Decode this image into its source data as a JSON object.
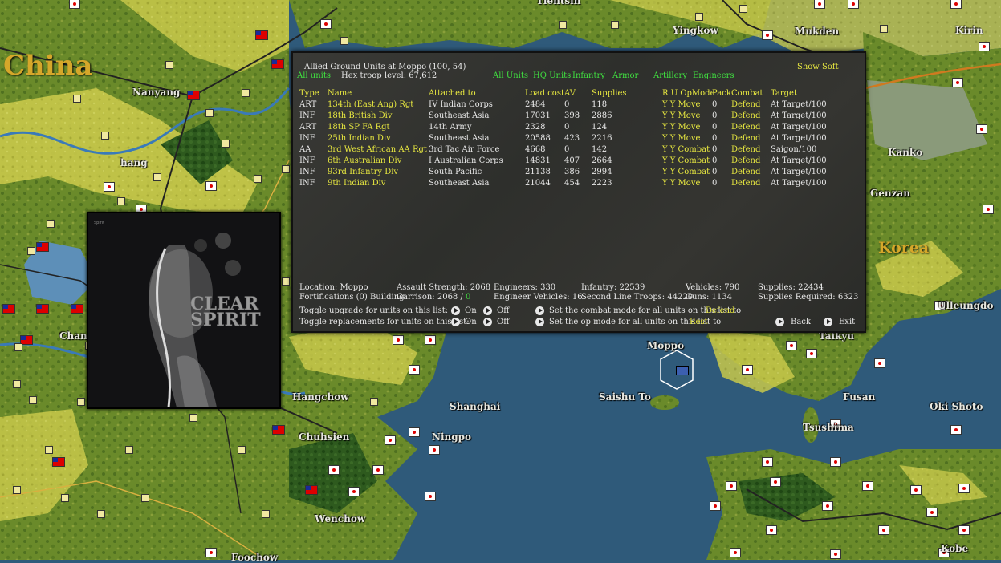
{
  "map": {
    "countries": [
      {
        "label": "China"
      },
      {
        "label": "Korea"
      }
    ],
    "places": [
      "Tientsin",
      "Yingkow",
      "Mukden",
      "Kirin",
      "Nanyang",
      "hang",
      "Kanko",
      "Genzan",
      "Ulleungdo",
      "Taikyu",
      "Moppo",
      "Saishu To",
      "Fusan",
      "Tsushima",
      "Oki Shoto",
      "Shanghai",
      "Ningpo",
      "Hangchow",
      "Chuhsien",
      "Wenchow",
      "Chang",
      "Kobe",
      "Foochow"
    ]
  },
  "panel": {
    "title": "Allied Ground Units at Moppo (100, 54)",
    "show_soft": "Show Soft",
    "all_units_left": "All units",
    "troop_level": "Hex troop level: 67,612",
    "filters": [
      "All Units",
      "HQ Units",
      "Infantry",
      "Armor",
      "Artillery",
      "Engineers"
    ],
    "headers": {
      "type": "Type",
      "name": "Name",
      "attached": "Attached to",
      "load": "Load cost",
      "av": "AV",
      "supplies": "Supplies",
      "ruopmode": "R U OpMode",
      "pack": "Pack",
      "combat": "Combat",
      "target": "Target"
    },
    "rows": [
      {
        "type": "ART",
        "name": "134th (East Ang) Rgt",
        "attached": "IV Indian Corps",
        "load": "2484",
        "av": "0",
        "supplies": "118",
        "ru": "Y Y Move",
        "pack": "0",
        "combat": "Defend",
        "target": "At Target/100"
      },
      {
        "type": "INF",
        "name": "18th British Div",
        "attached": "Southeast Asia",
        "load": "17031",
        "av": "398",
        "supplies": "2886",
        "ru": "Y Y Move",
        "pack": "0",
        "combat": "Defend",
        "target": "At Target/100"
      },
      {
        "type": "ART",
        "name": "18th SP FA Rgt",
        "attached": "14th Army",
        "load": "2328",
        "av": "0",
        "supplies": "124",
        "ru": "Y Y Move",
        "pack": "0",
        "combat": "Defend",
        "target": "At Target/100"
      },
      {
        "type": "INF",
        "name": "25th Indian Div",
        "attached": "Southeast Asia",
        "load": "20588",
        "av": "423",
        "supplies": "2216",
        "ru": "Y Y Move",
        "pack": "0",
        "combat": "Defend",
        "target": "At Target/100"
      },
      {
        "type": "AA",
        "name": "3rd West African AA Rgt",
        "attached": "3rd Tac Air Force",
        "load": "4668",
        "av": "0",
        "supplies": "142",
        "ru": "Y Y Combat",
        "pack": "0",
        "combat": "Defend",
        "target": "Saigon/100"
      },
      {
        "type": "INF",
        "name": "6th Australian Div",
        "attached": "I Australian Corps",
        "load": "14831",
        "av": "407",
        "supplies": "2664",
        "ru": "Y Y Combat",
        "pack": "0",
        "combat": "Defend",
        "target": "At Target/100"
      },
      {
        "type": "INF",
        "name": "93rd Infantry Div",
        "attached": "South Pacific",
        "load": "21138",
        "av": "386",
        "supplies": "2994",
        "ru": "Y Y Combat",
        "pack": "0",
        "combat": "Defend",
        "target": "At Target/100"
      },
      {
        "type": "INF",
        "name": "9th Indian Div",
        "attached": "Southeast Asia",
        "load": "21044",
        "av": "454",
        "supplies": "2223",
        "ru": "Y Y Move",
        "pack": "0",
        "combat": "Defend",
        "target": "At Target/100"
      }
    ],
    "stats": {
      "location": "Location: Moppo",
      "fortifications": "Fortifications (0) Building",
      "assault": "Assault Strength: 2068",
      "garrison_label": "Garrison: 2068 /",
      "garrison_value": "0",
      "engineers": "Engineers: 330",
      "eng_vehicles": "Engineer Vehicles: 16",
      "infantry": "Infantry: 22539",
      "second_line": "Second Line Troops: 44220",
      "vehicles": "Vehicles: 790",
      "guns": "Guns: 1134",
      "supplies": "Supplies: 22434",
      "supplies_req": "Supplies Required: 6323"
    },
    "controls": {
      "toggle_upgrade": "Toggle upgrade for units on this list:",
      "toggle_replacements": "Toggle replacements for units on this list:",
      "on": "On",
      "off": "Off",
      "combat_mode": "Set the combat mode for all units on this list to",
      "combat_mode_value": "Defend",
      "op_mode": "Set the op mode for all units on this list to",
      "op_mode_value": "Rest",
      "back": "Back",
      "exit": "Exit"
    }
  },
  "album": {
    "cover_text_line1": "CLEAR",
    "cover_text_line2": "SPIRIT",
    "small_label": "Spirit"
  }
}
